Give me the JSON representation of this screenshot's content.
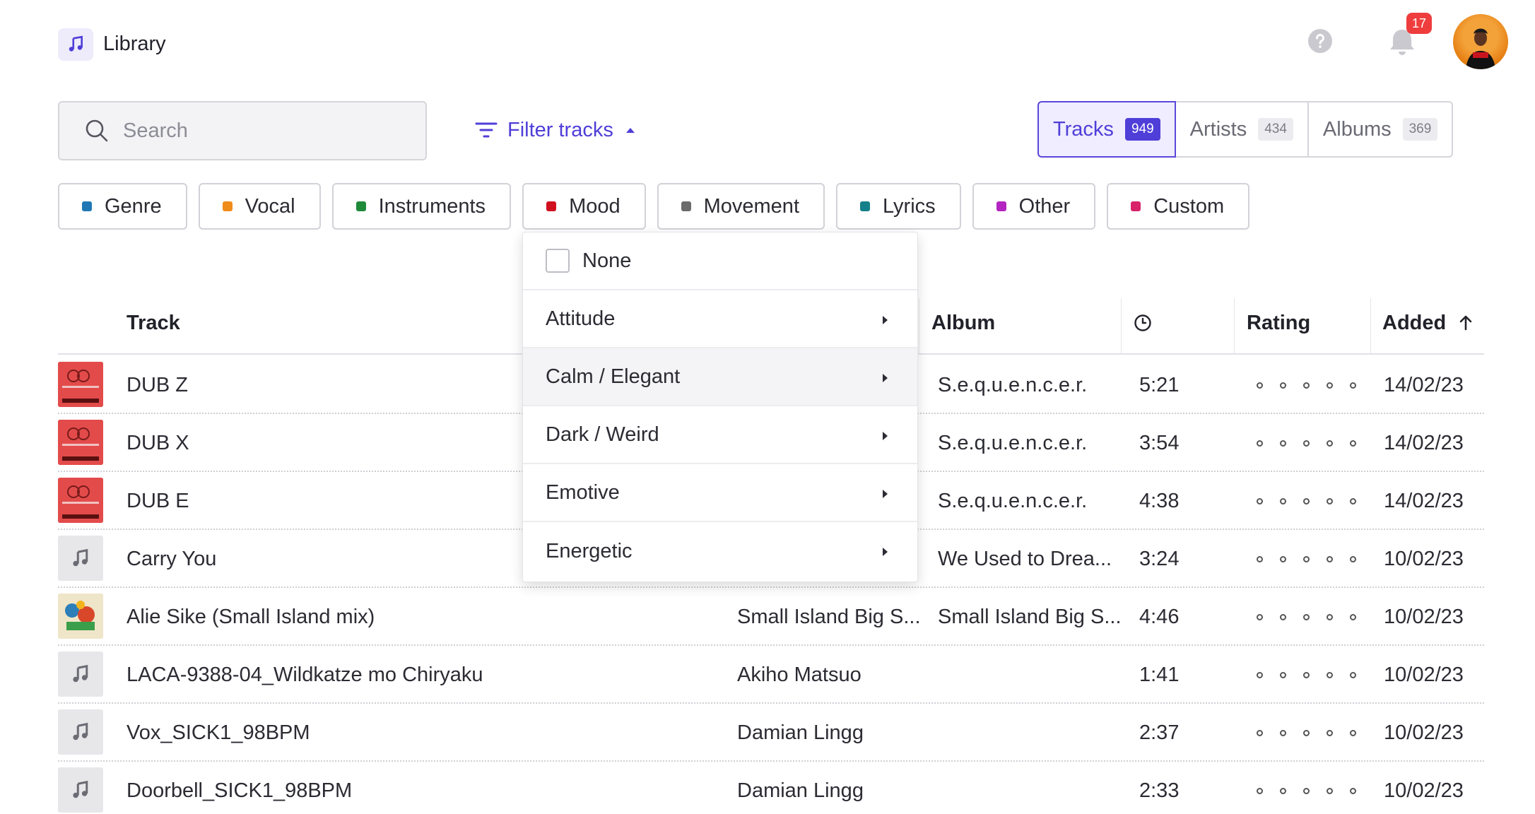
{
  "header": {
    "title": "Library",
    "notifications_count": "17",
    "icons": {
      "logo": "music-note-icon",
      "help": "help-circle-icon",
      "bell": "bell-icon"
    }
  },
  "search": {
    "placeholder": "Search"
  },
  "filter_toggle": {
    "label": "Filter tracks"
  },
  "tabs": [
    {
      "label": "Tracks",
      "count": "949",
      "active": true
    },
    {
      "label": "Artists",
      "count": "434",
      "active": false
    },
    {
      "label": "Albums",
      "count": "369",
      "active": false
    }
  ],
  "categories": [
    {
      "label": "Genre",
      "color": "#1f78b4"
    },
    {
      "label": "Vocal",
      "color": "#f08c1a"
    },
    {
      "label": "Instruments",
      "color": "#1e8a3a"
    },
    {
      "label": "Mood",
      "color": "#d0101e"
    },
    {
      "label": "Movement",
      "color": "#6b6b6b"
    },
    {
      "label": "Lyrics",
      "color": "#14808a"
    },
    {
      "label": "Other",
      "color": "#b324c0"
    },
    {
      "label": "Custom",
      "color": "#d8226a"
    }
  ],
  "dropdown": {
    "none_label": "None",
    "items": [
      "Attitude",
      "Calm / Elegant",
      "Dark / Weird",
      "Emotive",
      "Energetic"
    ],
    "hovered": "Calm / Elegant"
  },
  "table": {
    "headers": {
      "track": "Track",
      "album": "Album",
      "rating": "Rating",
      "added": "Added"
    },
    "rows": [
      {
        "title": "DUB Z",
        "artist": "",
        "album": "S.e.q.u.e.n.c.e.r.",
        "duration": "5:21",
        "added": "14/02/23",
        "thumb": "red"
      },
      {
        "title": "DUB X",
        "artist": "",
        "album": "S.e.q.u.e.n.c.e.r.",
        "duration": "3:54",
        "added": "14/02/23",
        "thumb": "red"
      },
      {
        "title": "DUB E",
        "artist": "",
        "album": "S.e.q.u.e.n.c.e.r.",
        "duration": "4:38",
        "added": "14/02/23",
        "thumb": "red"
      },
      {
        "title": "Carry You",
        "artist": "",
        "album": "We Used to Drea...",
        "duration": "3:24",
        "added": "10/02/23",
        "thumb": "placeholder"
      },
      {
        "title": "Alie Sike (Small Island mix)",
        "artist": "Small Island Big S...",
        "album": "Small Island Big S...",
        "duration": "4:46",
        "added": "10/02/23",
        "thumb": "art"
      },
      {
        "title": "LACA-9388-04_Wildkatze mo Chiryaku",
        "artist": "Akiho Matsuo",
        "album": "",
        "duration": "1:41",
        "added": "10/02/23",
        "thumb": "placeholder"
      },
      {
        "title": "Vox_SICK1_98BPM",
        "artist": "Damian Lingg",
        "album": "",
        "duration": "2:37",
        "added": "10/02/23",
        "thumb": "placeholder"
      },
      {
        "title": "Doorbell_SICK1_98BPM",
        "artist": "Damian Lingg",
        "album": "",
        "duration": "2:33",
        "added": "10/02/23",
        "thumb": "placeholder"
      }
    ]
  }
}
